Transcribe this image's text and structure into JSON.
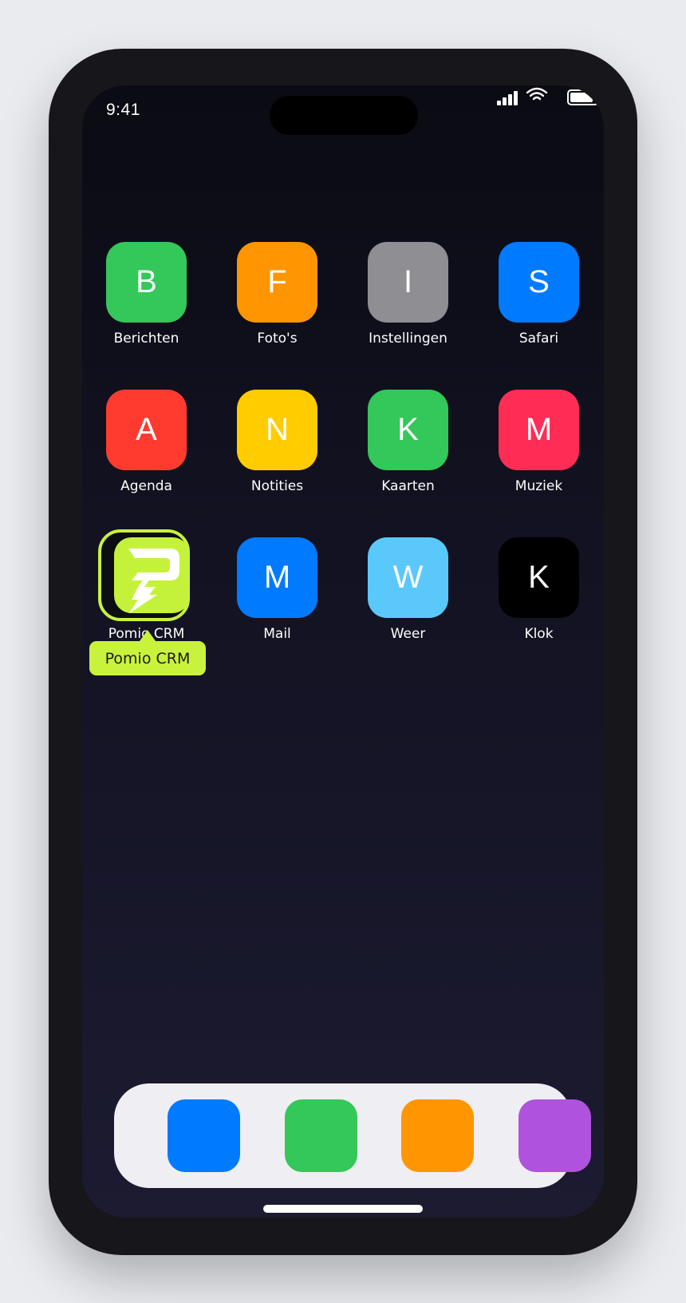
{
  "status_bar": {
    "time": "9:41"
  },
  "apps": [
    {
      "label": "Berichten",
      "letter": "B",
      "color": "#34c759"
    },
    {
      "label": "Foto's",
      "letter": "F",
      "color": "#ff9500"
    },
    {
      "label": "Instellingen",
      "letter": "I",
      "color": "#8e8e93"
    },
    {
      "label": "Safari",
      "letter": "S",
      "color": "#007aff"
    },
    {
      "label": "Agenda",
      "letter": "A",
      "color": "#ff3b30"
    },
    {
      "label": "Notities",
      "letter": "N",
      "color": "#ffcc00"
    },
    {
      "label": "Kaarten",
      "letter": "K",
      "color": "#34c759"
    },
    {
      "label": "Muziek",
      "letter": "M",
      "color": "#ff2d55"
    },
    {
      "label": "Pomio CRM",
      "letter": "",
      "color": "#c4f23a"
    },
    {
      "label": "Mail",
      "letter": "M",
      "color": "#007aff"
    },
    {
      "label": "Weer",
      "letter": "W",
      "color": "#5ac8fa"
    },
    {
      "label": "Klok",
      "letter": "K",
      "color": "#000000"
    }
  ],
  "tooltip": {
    "text": "Pomio CRM"
  },
  "dock": [
    {
      "color": "#007aff"
    },
    {
      "color": "#34c759"
    },
    {
      "color": "#ff9500"
    },
    {
      "color": "#af52de"
    }
  ]
}
